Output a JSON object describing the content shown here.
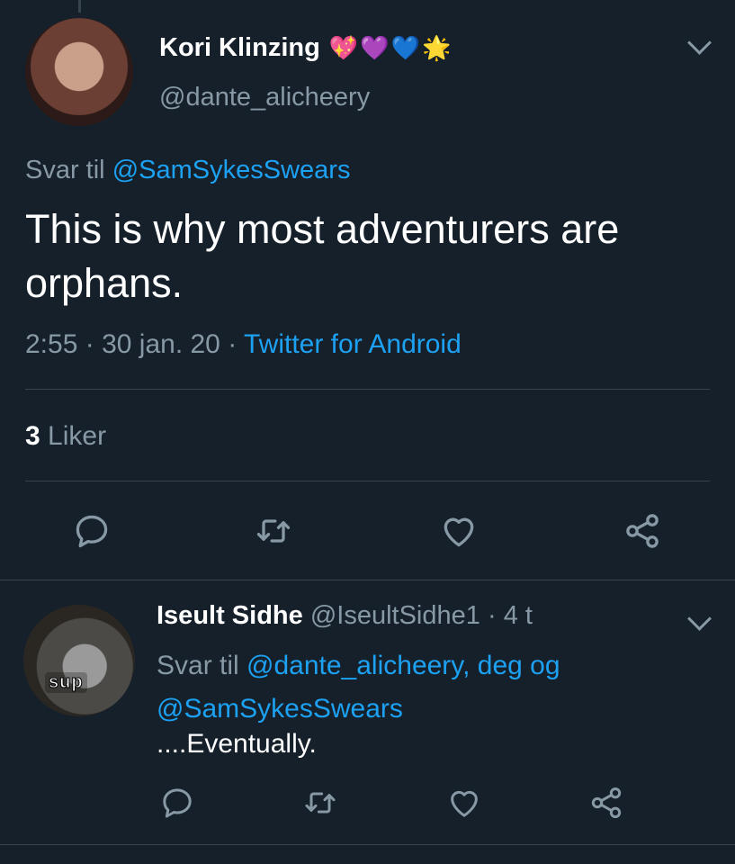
{
  "main_tweet": {
    "author_name": "Kori Klinzing",
    "emojis": [
      "💖",
      "💜",
      "💙",
      "🌟"
    ],
    "handle": "@dante_alicheery",
    "reply_prefix": "Svar til",
    "reply_mention": "@SamSykesSwears",
    "text": "This is why most adventurers are orphans.",
    "time": "2:55",
    "date": "30 jan. 20",
    "meta_sep": "·",
    "app": "Twitter for Android",
    "likes_count": "3",
    "likes_label": "Liker"
  },
  "reply_tweet": {
    "author_name": "Iseult Sidhe",
    "handle": "@IseultSidhe1",
    "time_sep": "·",
    "time": "4 t",
    "reply_prefix": "Svar til",
    "reply_mention_1": "@dante_alicheery,",
    "reply_connector": "deg og",
    "reply_mention_2": "@SamSykesSwears",
    "text": "....Eventually.",
    "avatar_caption": "sup"
  },
  "colors": {
    "background": "#15202b",
    "text_primary": "#ffffff",
    "text_secondary": "#8899a6",
    "accent": "#1da1f2",
    "divider": "#38444d"
  },
  "icons": [
    "chevron-down-icon",
    "reply-icon",
    "retweet-icon",
    "like-icon",
    "share-icon"
  ]
}
